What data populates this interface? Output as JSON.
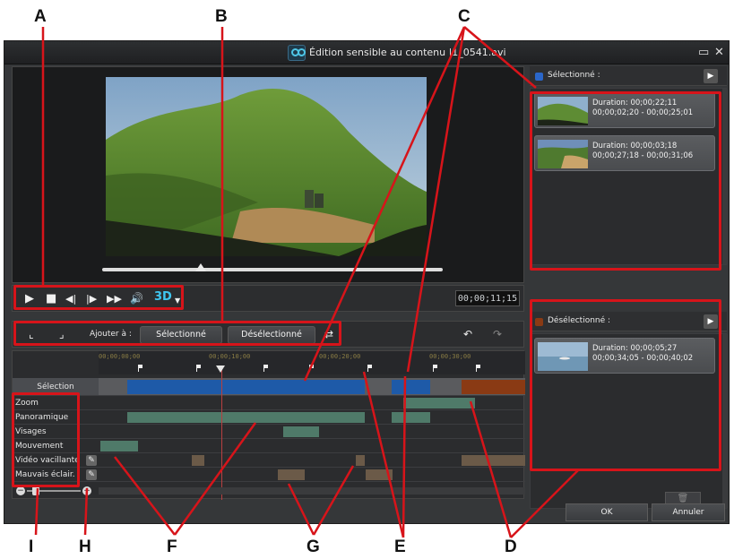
{
  "window": {
    "title": "Édition sensible au contenu  |1_0541.avi",
    "maximize_glyph": "▭",
    "close_glyph": "✕"
  },
  "player": {
    "timecode": "00;00;11;15",
    "mode_3d": "3D",
    "playback_progress": 0.29
  },
  "add_bar": {
    "add_label": "Ajouter à :",
    "selected_button": "Sélectionné",
    "deselected_button": "Désélectionné"
  },
  "timeline": {
    "ruler_ticks": [
      "00;00;00;00",
      "00;00;10;00",
      "00;00;20;00",
      "00;00;30;00"
    ],
    "rows": [
      {
        "label": "Sélection"
      },
      {
        "label": "Zoom"
      },
      {
        "label": "Panoramique"
      },
      {
        "label": "Visages"
      },
      {
        "label": "Mouvement"
      },
      {
        "label": "Vidéo vacillante"
      },
      {
        "label": "Mauvais éclair."
      }
    ],
    "zoom_minus": "−",
    "zoom_plus": "+"
  },
  "selected_pane": {
    "header": "Sélectionné :",
    "clips": [
      {
        "duration": "Duration: 00;00;22;11",
        "range": "00;00;02;20 - 00;00;25;01"
      },
      {
        "duration": "Duration: 00;00;03;18",
        "range": "00;00;27;18 - 00;00;31;06"
      }
    ]
  },
  "deselected_pane": {
    "header": "Désélectionné :",
    "clips": [
      {
        "duration": "Duration: 00;00;05;27",
        "range": "00;00;34;05 - 00;00;40;02"
      }
    ]
  },
  "footer": {
    "ok": "OK",
    "cancel": "Annuler"
  },
  "callouts": {
    "A": "A",
    "B": "B",
    "C": "C",
    "D": "D",
    "E": "E",
    "F": "F",
    "G": "G",
    "H": "H",
    "I": "I"
  },
  "colors": {
    "selected_blue": "#1e5aa8",
    "deselected_orange": "#8a3a14",
    "segment_green": "#4f7a69",
    "segment_tan": "#6b5a48",
    "annotation_red": "#d7141a"
  }
}
